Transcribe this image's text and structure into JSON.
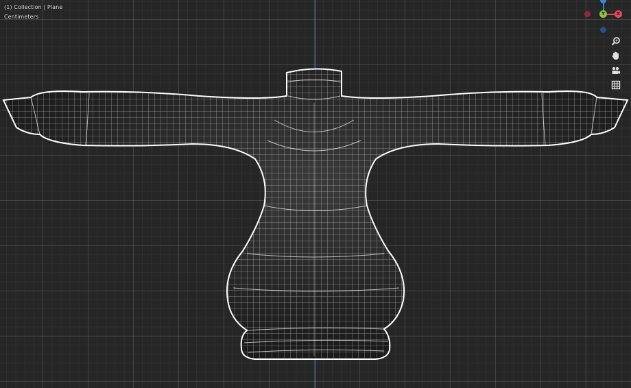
{
  "viewport": {
    "collection_label": "(1) Collection | Plane",
    "units_label": "Centimeters",
    "background": "#262626",
    "wire_color": "#ffffff",
    "axis_color": "#3d6fb6"
  },
  "gizmo": {
    "y_label": "Y",
    "x_label": "X",
    "colors": {
      "x": "#e84a5f",
      "x_negative": "#8e2c3a",
      "y": "#8cc63f",
      "z": "#3d83d8",
      "z_negative": "#2b4f86"
    }
  },
  "nav_tools": [
    {
      "name": "zoom",
      "icon": "magnifier-icon"
    },
    {
      "name": "pan",
      "icon": "hand-icon"
    },
    {
      "name": "camera",
      "icon": "camera-icon"
    },
    {
      "name": "grid",
      "icon": "grid-icon"
    }
  ]
}
